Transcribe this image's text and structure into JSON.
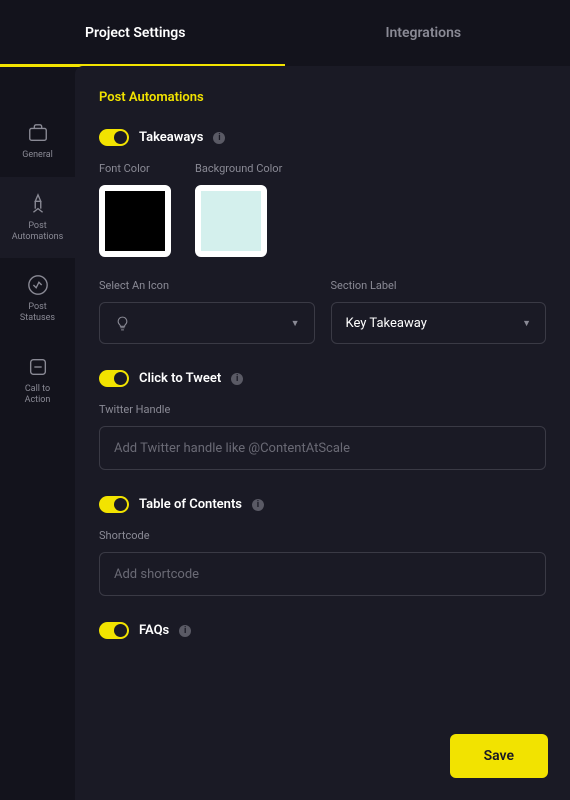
{
  "tabs": {
    "project_settings": "Project Settings",
    "integrations": "Integrations"
  },
  "sidebar": {
    "general": "General",
    "post_automations": "Post\nAutomations",
    "post_statuses": "Post\nStatuses",
    "call_to_action": "Call to\nAction"
  },
  "section": {
    "title": "Post Automations"
  },
  "takeaways": {
    "label": "Takeaways",
    "font_color_label": "Font Color",
    "bg_color_label": "Background Color",
    "font_color": "#000000",
    "bg_color": "#d4f0ed",
    "select_icon_label": "Select An Icon",
    "section_label_label": "Section Label",
    "section_label_value": "Key Takeaway"
  },
  "click_to_tweet": {
    "label": "Click to Tweet",
    "handle_label": "Twitter Handle",
    "handle_placeholder": "Add Twitter handle like @ContentAtScale"
  },
  "toc": {
    "label": "Table of Contents",
    "shortcode_label": "Shortcode",
    "shortcode_placeholder": "Add shortcode"
  },
  "faqs": {
    "label": "FAQs"
  },
  "buttons": {
    "save": "Save"
  }
}
